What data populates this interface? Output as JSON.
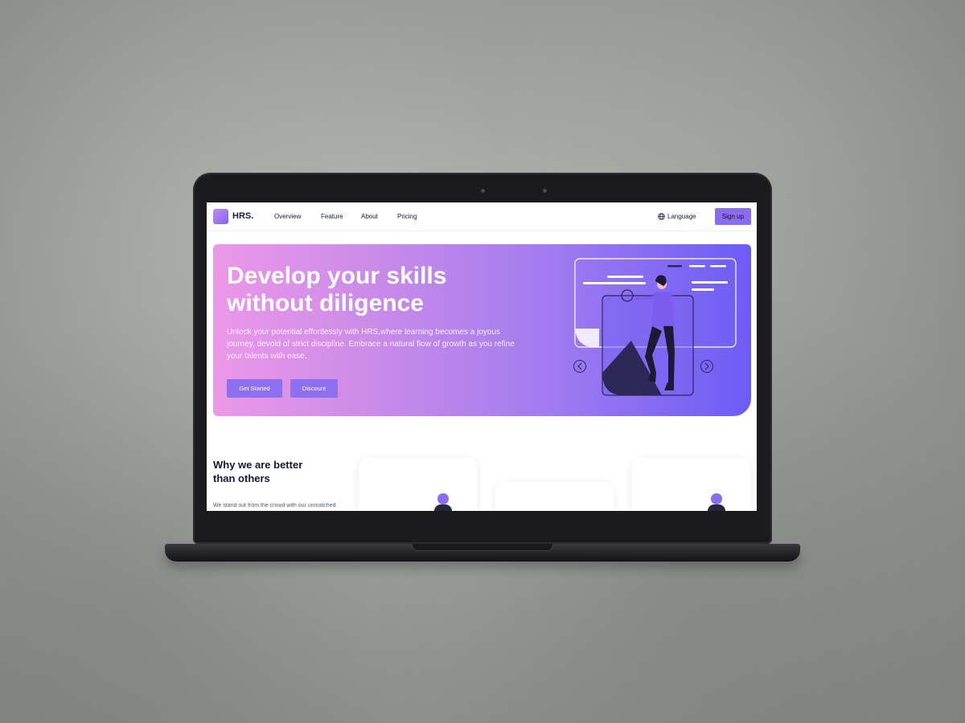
{
  "nav": {
    "logo": "HRS.",
    "links": [
      "Overview",
      "Feature",
      "About",
      "Pricing"
    ],
    "language": "Language",
    "signup": "Sign up"
  },
  "hero": {
    "title": "Develop your skills without diligence",
    "description": "Unlock your potential effortlessly with HRS,where learning becomes a joyous journey, devoid of strict discipline. Embrace a natural flow of growth as you refine your talents with ease.",
    "primary_button": "Get Started",
    "secondary_button": "Discount"
  },
  "why": {
    "title": "Why we are better than others",
    "subtitle": "We stand out from the crowd with our unmatched"
  },
  "icons": [
    "globe-icon",
    "chevron-left-icon",
    "chevron-right-icon"
  ],
  "colors": {
    "accent": "#8a6cf0",
    "hero_start": "#ec98e8",
    "hero_end": "#6c5cf6",
    "text_dark": "#141a3a"
  }
}
